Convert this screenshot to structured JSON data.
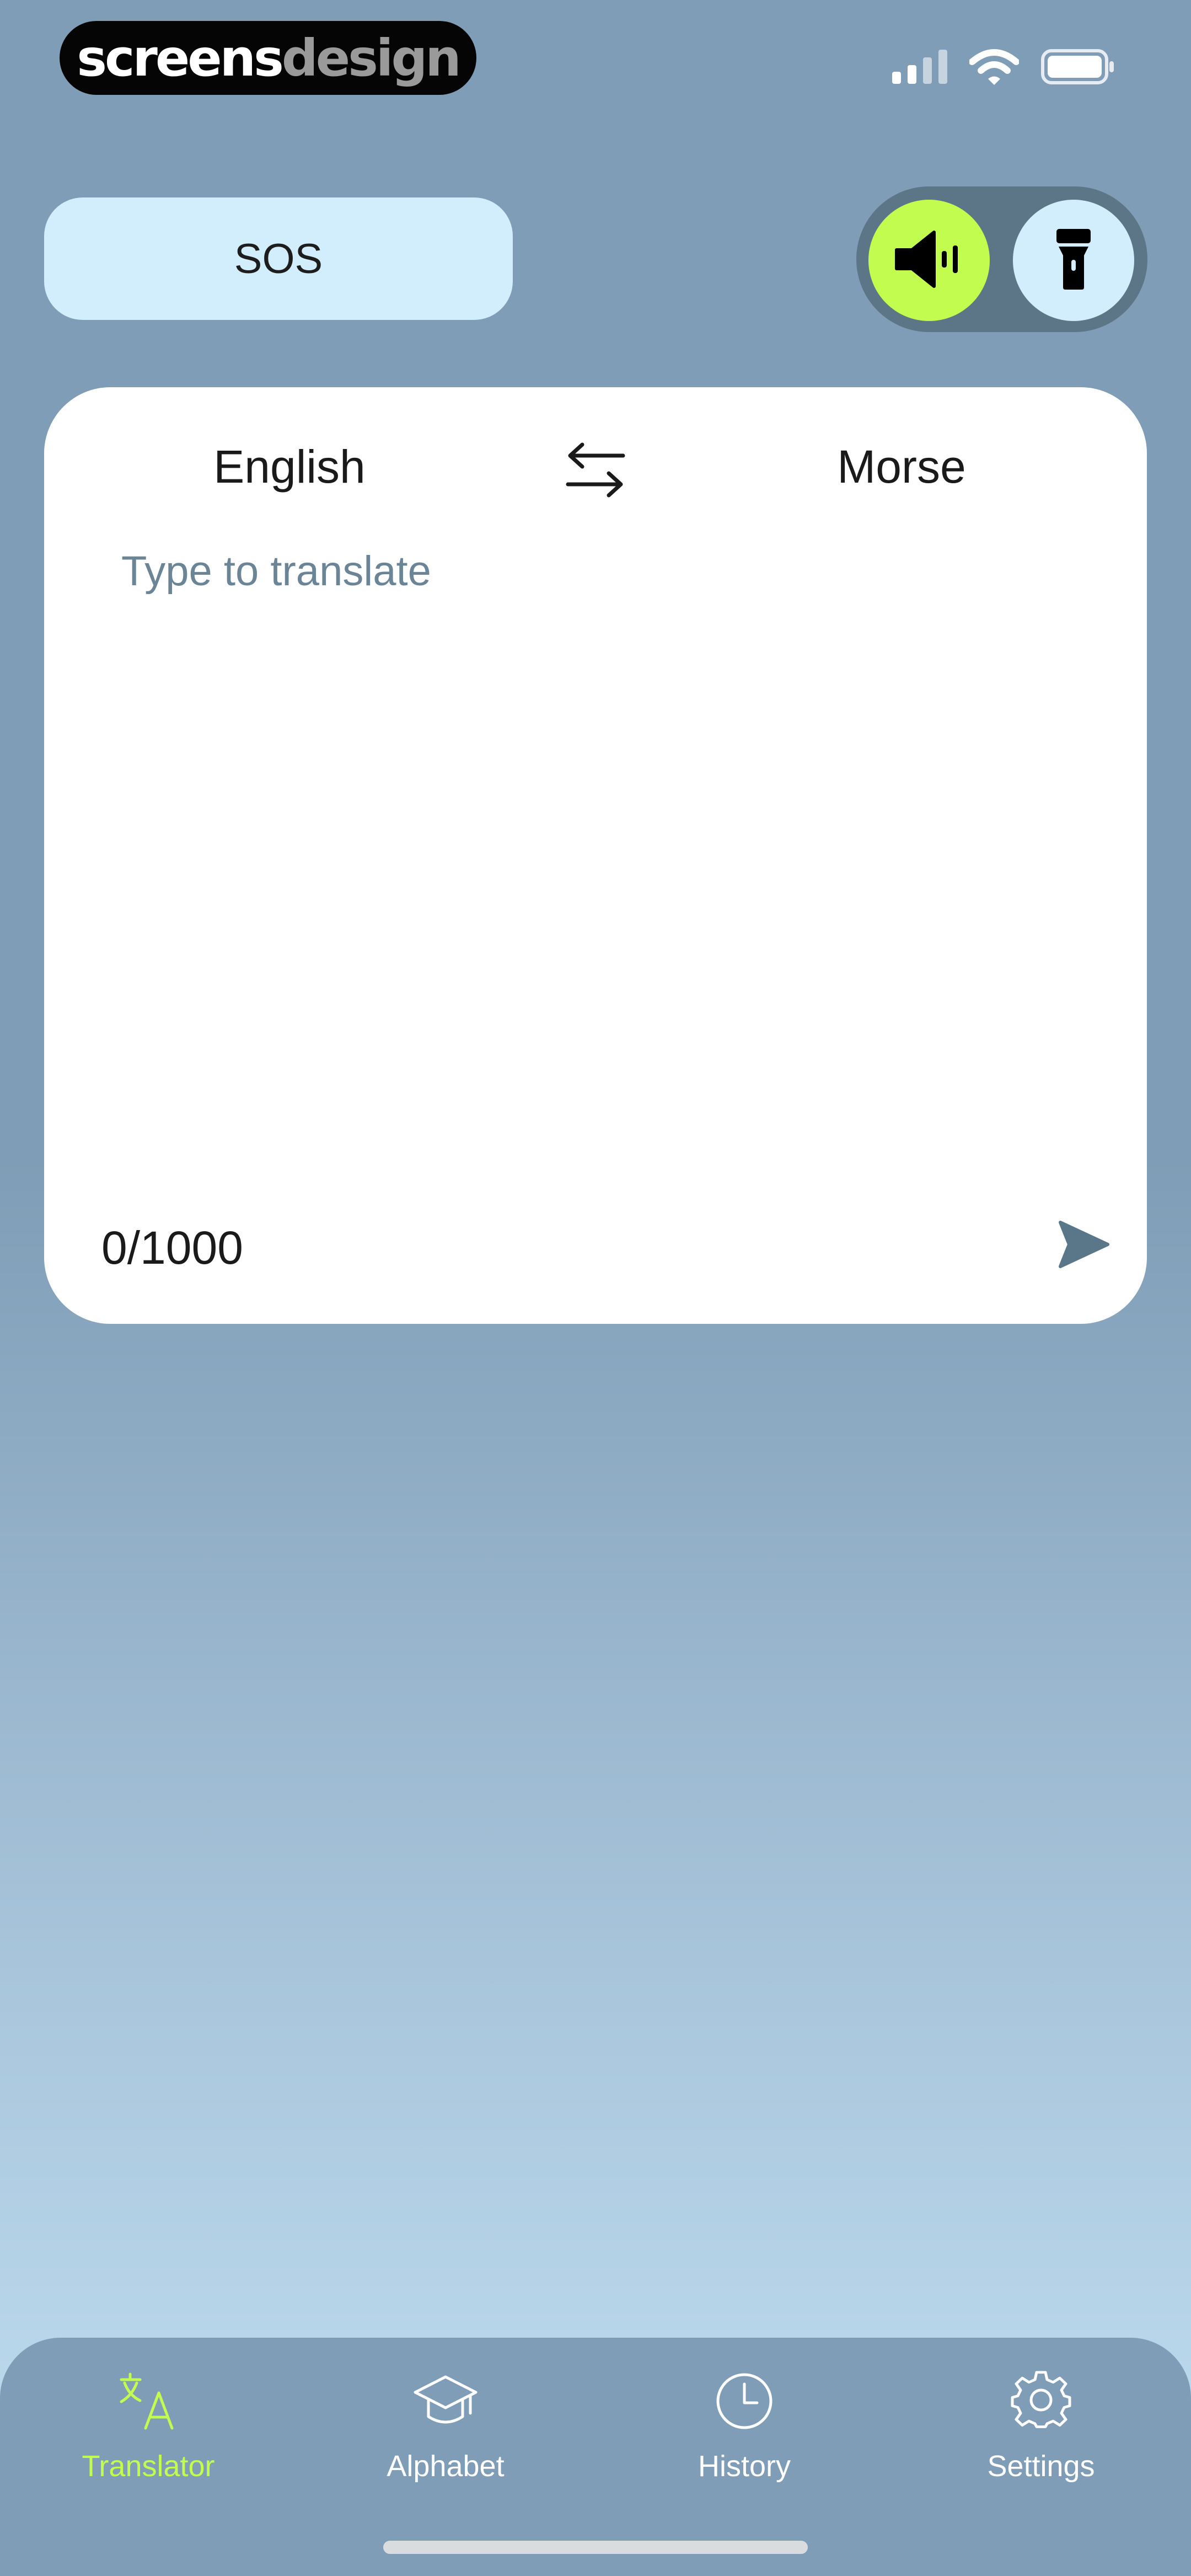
{
  "watermark": {
    "part1": "screens",
    "part2": "design"
  },
  "status_bar": {
    "signal_icon": "cellular-signal-icon",
    "wifi_icon": "wifi-icon",
    "battery_icon": "battery-icon"
  },
  "sos_button": {
    "label": "SOS"
  },
  "mode_toggle": {
    "sound_icon": "speaker-icon",
    "flashlight_icon": "flashlight-icon",
    "active": "sound",
    "active_color": "#c2fc4f",
    "inactive_color": "#d2edfc"
  },
  "translator": {
    "source_language": "English",
    "target_language": "Morse",
    "swap_icon": "swap-arrows-icon",
    "input": {
      "value": "",
      "placeholder": "Type to translate"
    },
    "char_count": "0/1000",
    "send_icon": "send-icon"
  },
  "tabs": [
    {
      "label": "Translator",
      "icon": "translate-icon",
      "active": true
    },
    {
      "label": "Alphabet",
      "icon": "graduation-cap-icon",
      "active": false
    },
    {
      "label": "History",
      "icon": "clock-icon",
      "active": false
    },
    {
      "label": "Settings",
      "icon": "gear-icon",
      "active": false
    }
  ],
  "colors": {
    "accent": "#c2fc4f",
    "background_top": "#7f9db6",
    "background_bottom": "#c2e0f2",
    "card": "#ffffff"
  }
}
